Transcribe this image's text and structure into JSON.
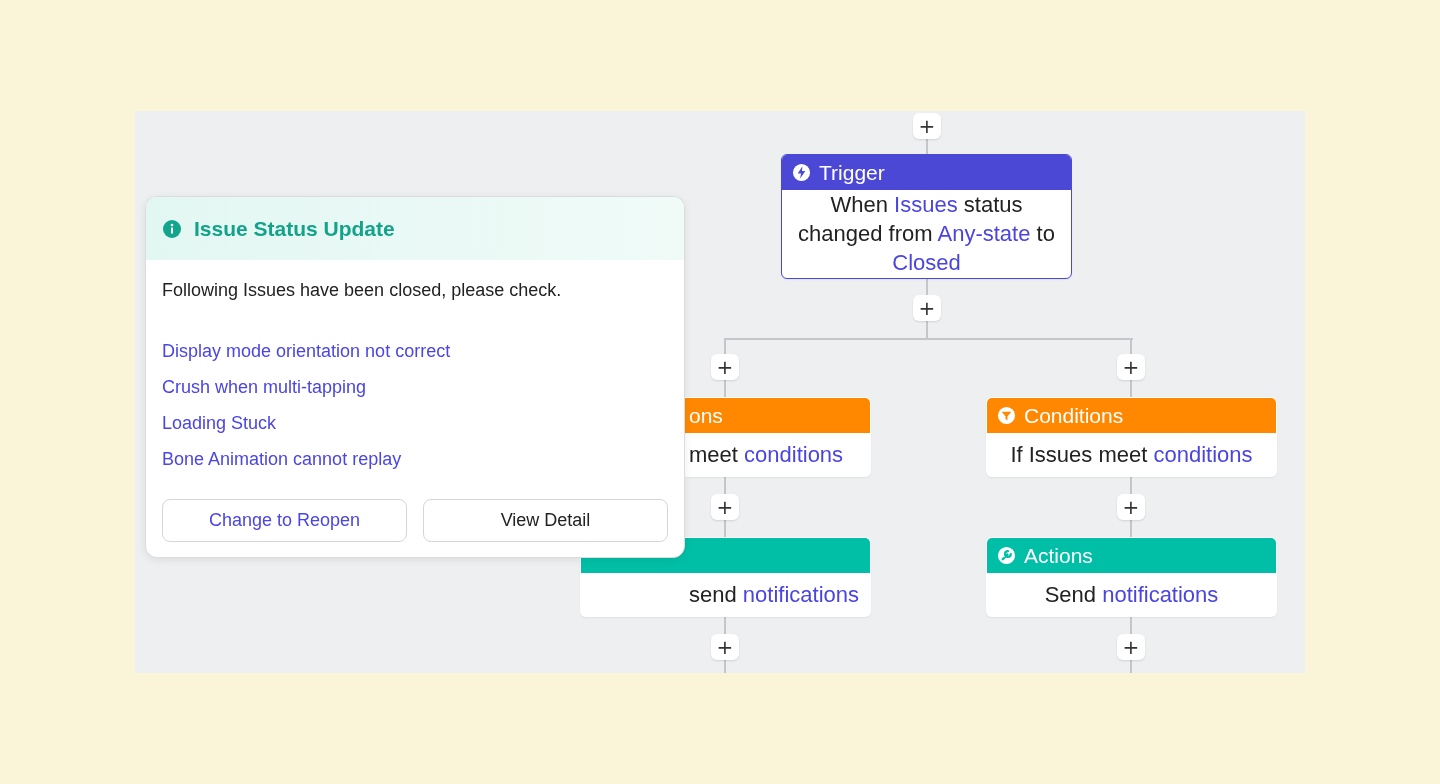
{
  "flow": {
    "top_add": "+",
    "trigger": {
      "kind": "trigger",
      "title": "Trigger",
      "covered": false,
      "body": [
        {
          "kind": "text",
          "text": "When "
        },
        {
          "kind": "token",
          "text": "Issues"
        },
        {
          "kind": "text",
          "text": " status changed from "
        },
        {
          "kind": "token",
          "text": "Any-state"
        },
        {
          "kind": "text",
          "text": " to "
        },
        {
          "kind": "token",
          "text": "Closed"
        }
      ],
      "add_below": "+"
    },
    "branches": [
      {
        "add": "+",
        "nodes": [
          {
            "kind": "conditions",
            "title": "ons",
            "covered": true,
            "body": [
              {
                "kind": "text",
                "text": "meet "
              },
              {
                "kind": "token",
                "text": "conditions"
              }
            ],
            "add_below": "+"
          },
          {
            "kind": "actions",
            "covered": true,
            "body": [
              {
                "kind": "text",
                "text": "send "
              },
              {
                "kind": "token",
                "text": "notifications"
              }
            ],
            "add_below": "+"
          }
        ]
      },
      {
        "add": "+",
        "nodes": [
          {
            "kind": "conditions",
            "title": "Conditions",
            "covered": false,
            "body": [
              {
                "kind": "text",
                "text": "If Issues meet "
              },
              {
                "kind": "token",
                "text": "conditions"
              }
            ],
            "add_below": "+"
          },
          {
            "kind": "actions",
            "title": "Actions",
            "covered": false,
            "body": [
              {
                "kind": "text",
                "text": "Send "
              },
              {
                "kind": "token",
                "text": "notifications"
              }
            ],
            "add_below": "+"
          }
        ]
      }
    ]
  },
  "popup": {
    "title": "Issue Status Update",
    "message": "Following Issues have been closed, please check.",
    "issues": [
      "Display mode orientation not correct",
      "Crush when multi-tapping",
      "Loading Stuck",
      "Bone Animation cannot replay"
    ],
    "buttons": [
      {
        "label": "Change to Reopen",
        "kind": "primary"
      },
      {
        "label": "View Detail",
        "kind": "default"
      }
    ]
  }
}
